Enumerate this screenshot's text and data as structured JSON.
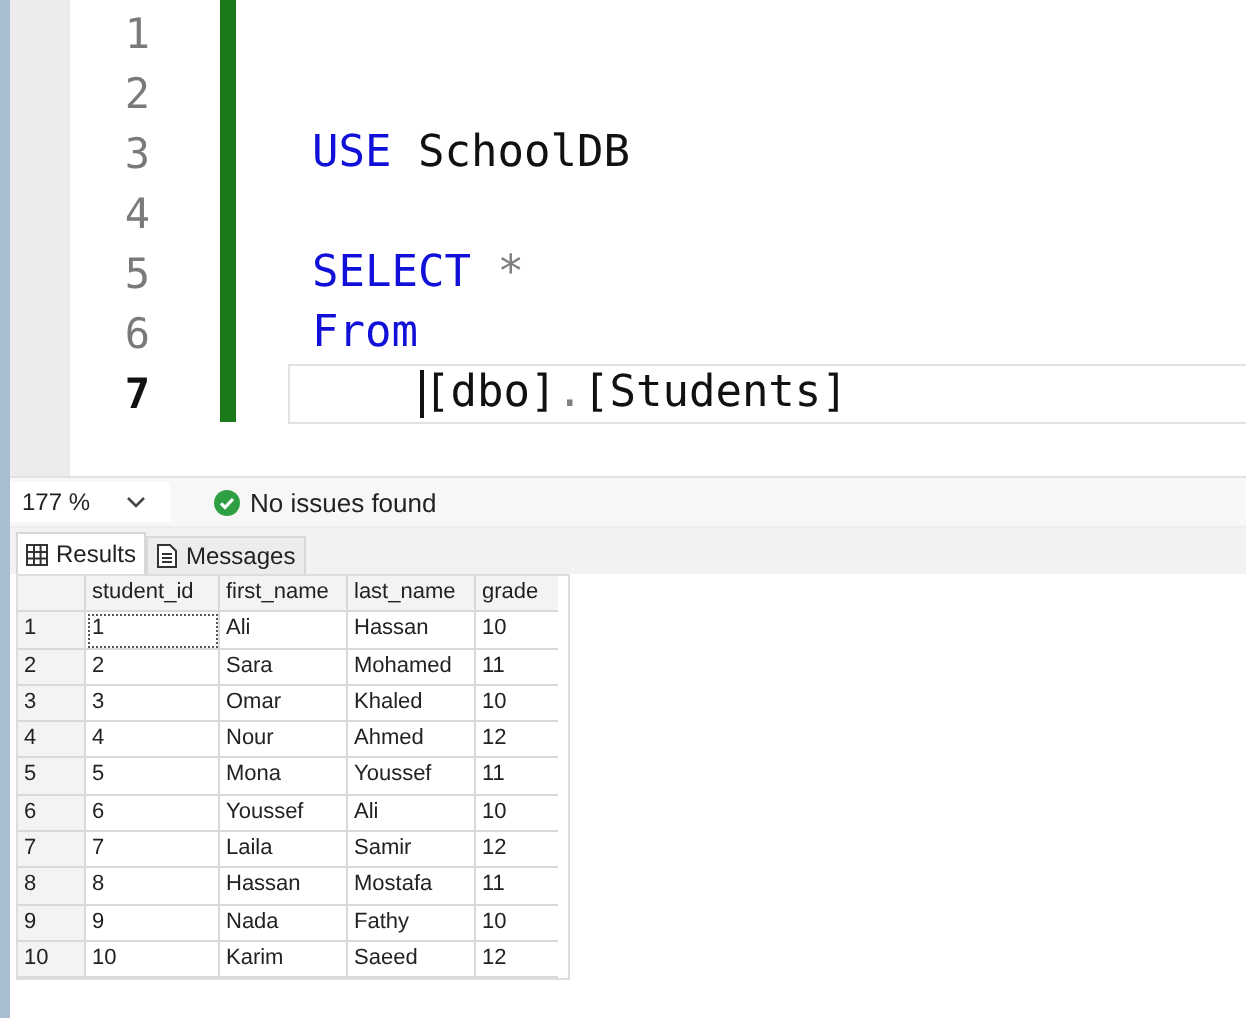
{
  "editor": {
    "lines": [
      {
        "number": "1",
        "current": false
      },
      {
        "number": "2",
        "current": false
      },
      {
        "number": "3",
        "current": false,
        "tokens": [
          {
            "kind": "keyword",
            "text": "USE"
          },
          {
            "kind": "identifier",
            "text": "SchoolDB"
          }
        ]
      },
      {
        "number": "4",
        "current": false
      },
      {
        "number": "5",
        "current": false,
        "tokens": [
          {
            "kind": "keyword",
            "text": "SELECT"
          },
          {
            "kind": "operator",
            "text": "*"
          }
        ]
      },
      {
        "number": "6",
        "current": false,
        "tokens": [
          {
            "kind": "keyword",
            "text": "From"
          }
        ]
      },
      {
        "number": "7",
        "current": true,
        "tokens": [
          {
            "kind": "identifier",
            "text": "    [dbo]",
            "caret_before": true
          },
          {
            "kind": "punct",
            "text": "."
          },
          {
            "kind": "identifier",
            "text": "[Students]"
          }
        ]
      }
    ]
  },
  "status_bar": {
    "zoom": "177 %",
    "message": "No issues found"
  },
  "tabs": [
    {
      "label": "Results",
      "selected": true
    },
    {
      "label": "Messages",
      "selected": false
    }
  ],
  "grid": {
    "columns": [
      "student_id",
      "first_name",
      "last_name",
      "grade"
    ],
    "rows": [
      {
        "number": "1",
        "cells": [
          {
            "text": "1",
            "focused": true
          },
          {
            "text": "Ali",
            "focused": false
          },
          {
            "text": "Hassan",
            "focused": false
          },
          {
            "text": "10",
            "focused": false
          }
        ]
      },
      {
        "number": "2",
        "cells": [
          {
            "text": "2",
            "focused": false
          },
          {
            "text": "Sara",
            "focused": false
          },
          {
            "text": "Mohamed",
            "focused": false
          },
          {
            "text": "11",
            "focused": false
          }
        ]
      },
      {
        "number": "3",
        "cells": [
          {
            "text": "3",
            "focused": false
          },
          {
            "text": "Omar",
            "focused": false
          },
          {
            "text": "Khaled",
            "focused": false
          },
          {
            "text": "10",
            "focused": false
          }
        ]
      },
      {
        "number": "4",
        "cells": [
          {
            "text": "4",
            "focused": false
          },
          {
            "text": "Nour",
            "focused": false
          },
          {
            "text": "Ahmed",
            "focused": false
          },
          {
            "text": "12",
            "focused": false
          }
        ]
      },
      {
        "number": "5",
        "cells": [
          {
            "text": "5",
            "focused": false
          },
          {
            "text": "Mona",
            "focused": false
          },
          {
            "text": "Youssef",
            "focused": false
          },
          {
            "text": "11",
            "focused": false
          }
        ]
      },
      {
        "number": "6",
        "cells": [
          {
            "text": "6",
            "focused": false
          },
          {
            "text": "Youssef",
            "focused": false
          },
          {
            "text": "Ali",
            "focused": false
          },
          {
            "text": "10",
            "focused": false
          }
        ]
      },
      {
        "number": "7",
        "cells": [
          {
            "text": "7",
            "focused": false
          },
          {
            "text": "Laila",
            "focused": false
          },
          {
            "text": "Samir",
            "focused": false
          },
          {
            "text": "12",
            "focused": false
          }
        ]
      },
      {
        "number": "8",
        "cells": [
          {
            "text": "8",
            "focused": false
          },
          {
            "text": "Hassan",
            "focused": false
          },
          {
            "text": "Mostafa",
            "focused": false
          },
          {
            "text": "11",
            "focused": false
          }
        ]
      },
      {
        "number": "9",
        "cells": [
          {
            "text": "9",
            "focused": false
          },
          {
            "text": "Nada",
            "focused": false
          },
          {
            "text": "Fathy",
            "focused": false
          },
          {
            "text": "10",
            "focused": false
          }
        ]
      },
      {
        "number": "10",
        "cells": [
          {
            "text": "10",
            "focused": false
          },
          {
            "text": "Karim",
            "focused": false
          },
          {
            "text": "Saeed",
            "focused": false
          },
          {
            "text": "12",
            "focused": false
          }
        ]
      }
    ]
  }
}
